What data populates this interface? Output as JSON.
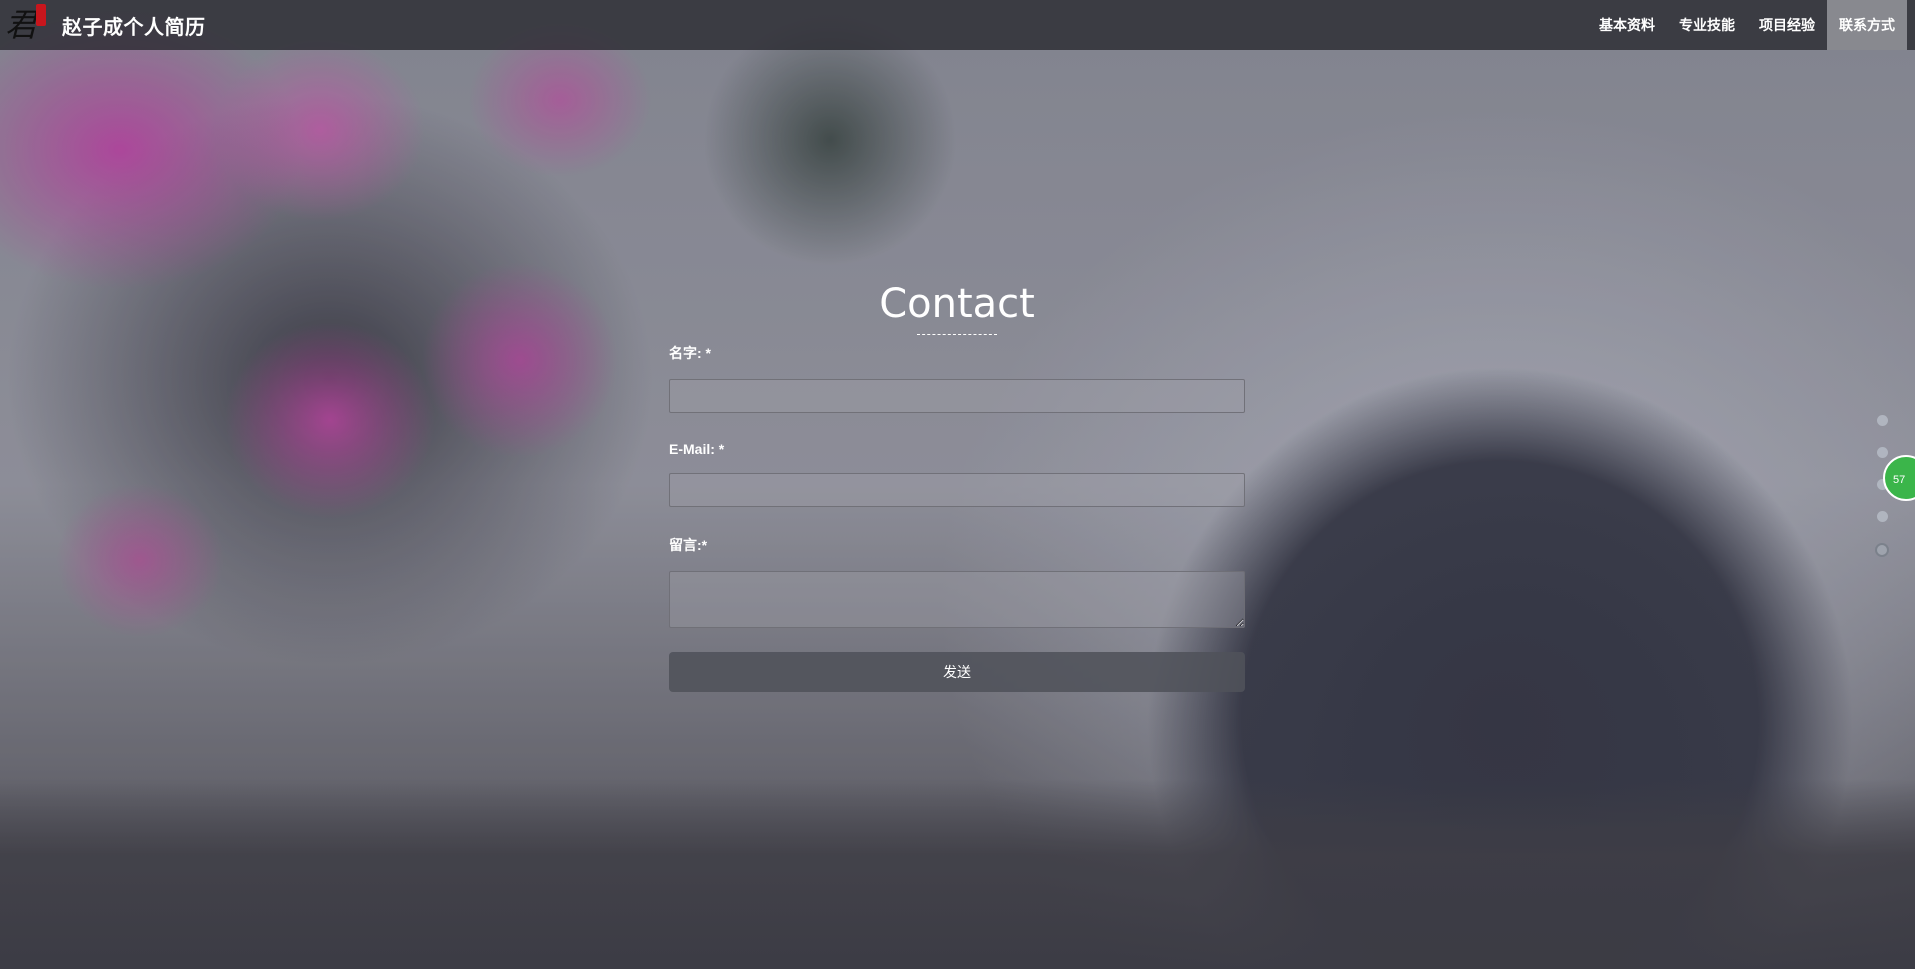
{
  "brand": {
    "logo_icon": "calligraphy-logo-icon",
    "name": "赵子成个人简历"
  },
  "nav": {
    "items": [
      {
        "label": "基本资料"
      },
      {
        "label": "专业技能"
      },
      {
        "label": "项目经验"
      },
      {
        "label": "联系方式"
      }
    ],
    "active_index": 3
  },
  "contact": {
    "title": "Contact",
    "name_label": "名字: *",
    "name_value": "",
    "email_label": "E-Mail: *",
    "email_value": "",
    "message_label": "留言:*",
    "message_value": "",
    "submit_label": "发送"
  },
  "side_nav": {
    "dot_count": 5,
    "active_index": 4
  },
  "floating_badge": {
    "text": "57"
  },
  "colors": {
    "navbar_bg": "#28282e",
    "active_nav_bg": "#96969c",
    "button_bg": "#50525a",
    "badge_green": "#3bb54a",
    "logo_seal_red": "#c8161d"
  }
}
